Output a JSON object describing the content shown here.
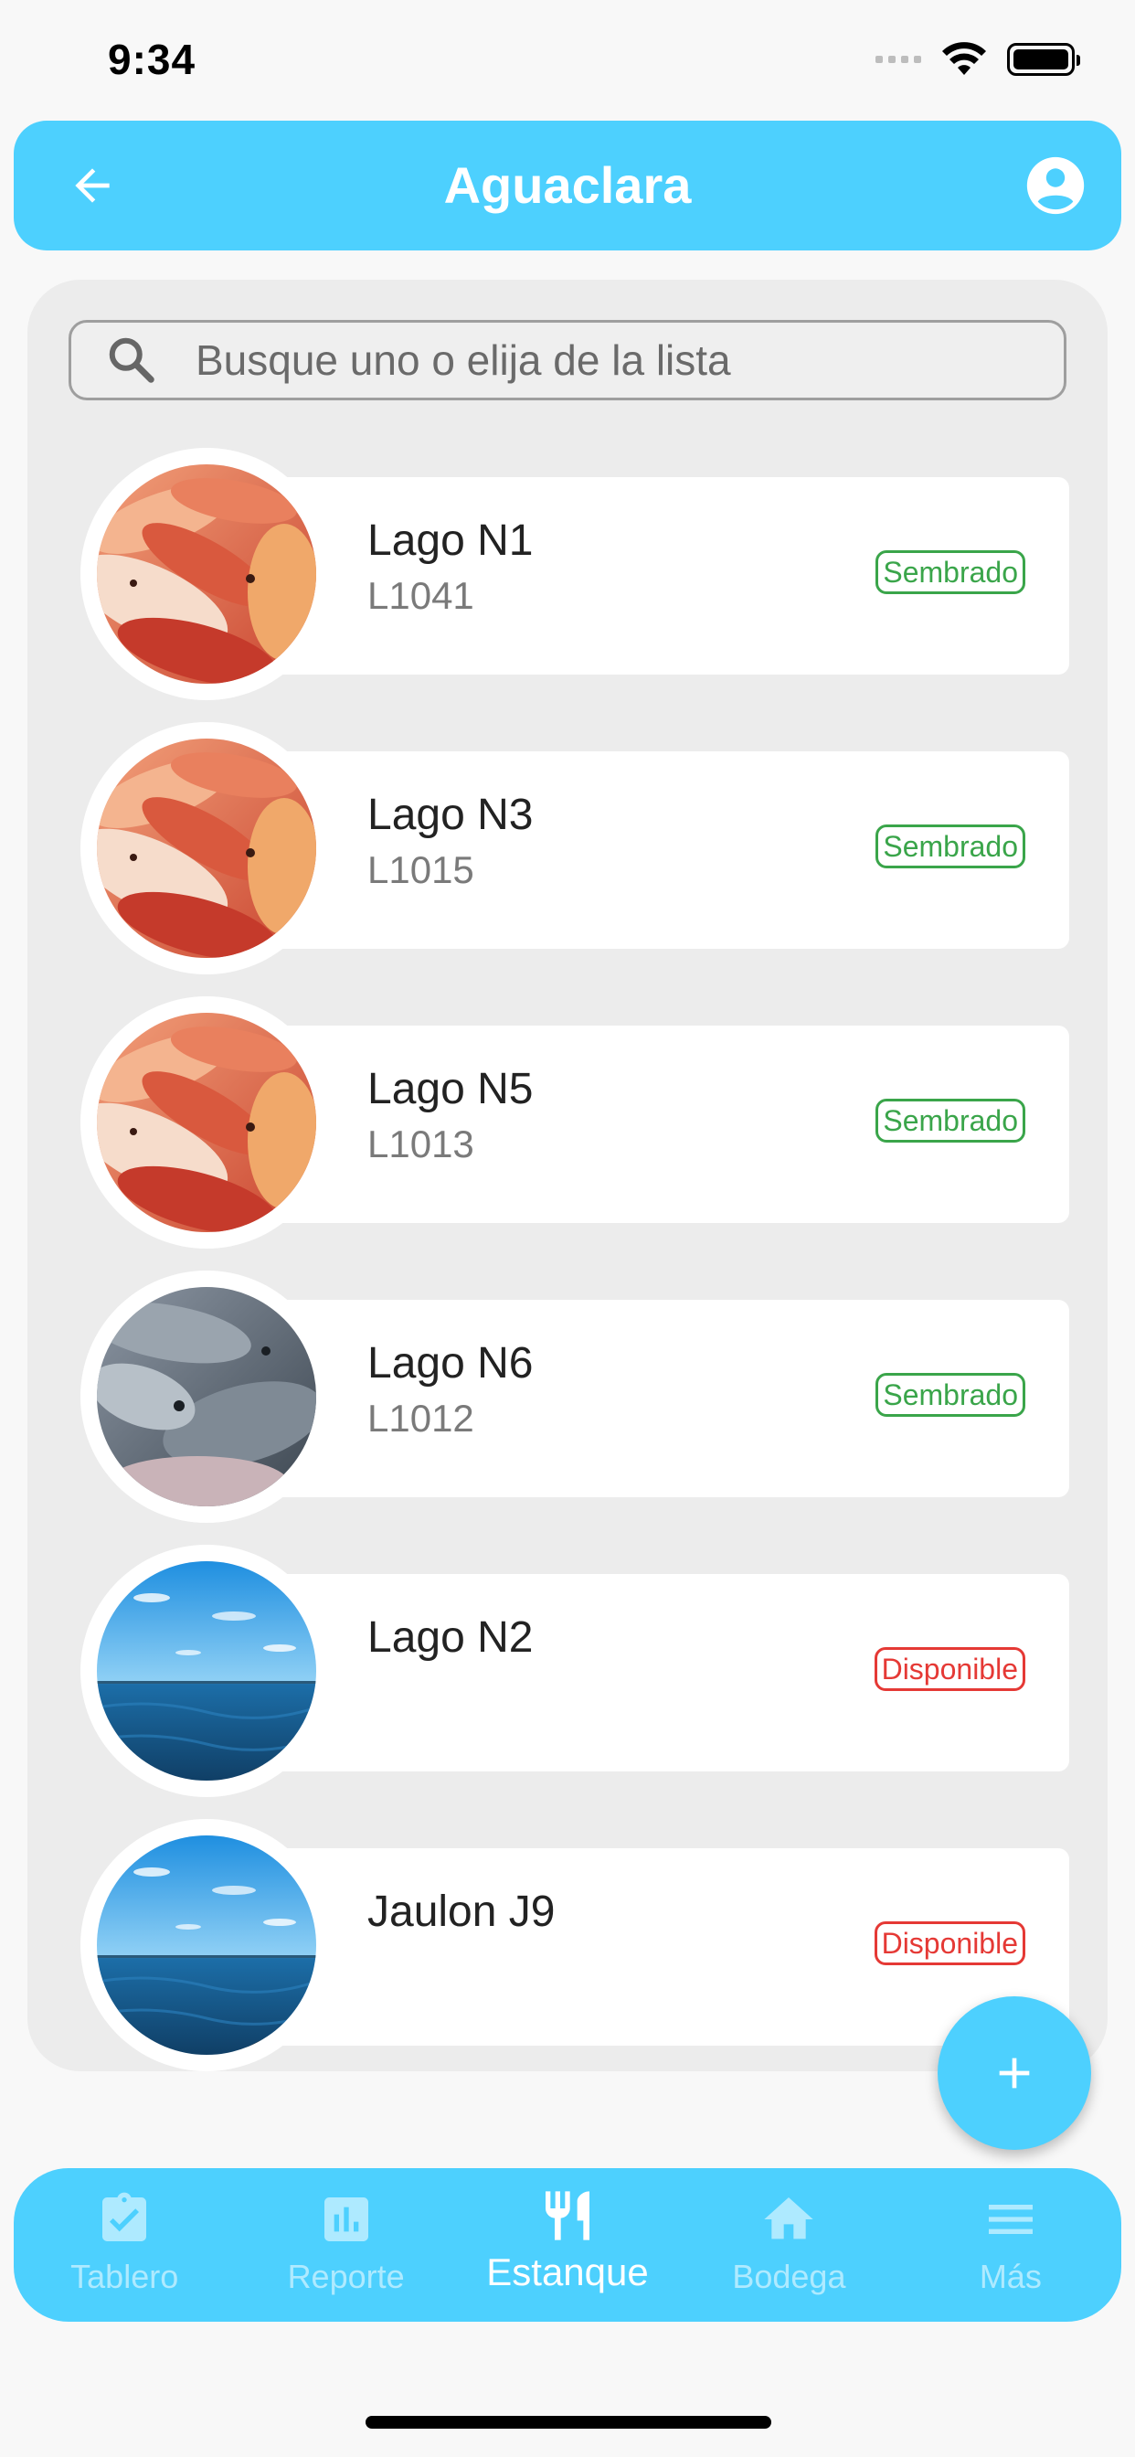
{
  "status_bar": {
    "time": "9:34"
  },
  "app_bar": {
    "title": "Aguaclara"
  },
  "search": {
    "placeholder": "Busque uno o elija de la lista"
  },
  "ponds": [
    {
      "name": "Lago N1",
      "code": "L1041",
      "status": "Sembrado",
      "image": "red-tilapia"
    },
    {
      "name": "Lago N3",
      "code": "L1015",
      "status": "Sembrado",
      "image": "red-tilapia"
    },
    {
      "name": "Lago N5",
      "code": "L1013",
      "status": "Sembrado",
      "image": "red-tilapia"
    },
    {
      "name": "Lago N6",
      "code": "L1012",
      "status": "Sembrado",
      "image": "gray-tilapia"
    },
    {
      "name": "Lago N2",
      "code": "",
      "status": "Disponible",
      "image": "lake-water"
    },
    {
      "name": "Jaulon J9",
      "code": "",
      "status": "Disponible",
      "image": "lake-water"
    }
  ],
  "status_colors": {
    "Sembrado": "#3aa54a",
    "Disponible": "#e53935"
  },
  "accent_color": "#4dd0fe",
  "fab": {
    "icon": "plus-icon"
  },
  "bottom_nav": {
    "items": [
      {
        "label": "Tablero",
        "icon": "clipboard-check-icon",
        "active": false
      },
      {
        "label": "Reporte",
        "icon": "bar-chart-icon",
        "active": false
      },
      {
        "label": "Estanque",
        "icon": "restaurant-icon",
        "active": true
      },
      {
        "label": "Bodega",
        "icon": "home-icon",
        "active": false
      },
      {
        "label": "Más",
        "icon": "menu-icon",
        "active": false
      }
    ]
  }
}
